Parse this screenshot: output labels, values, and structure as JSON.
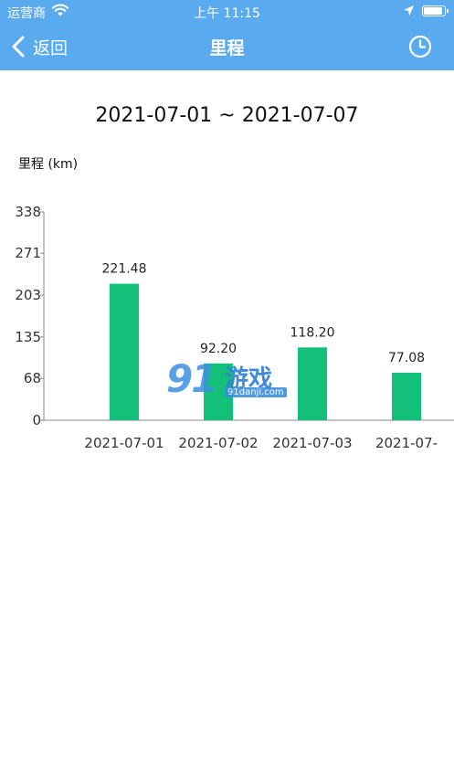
{
  "status_bar": {
    "carrier": "运营商",
    "time": "上午 11:15",
    "icons": [
      "wifi-icon",
      "location-arrow-icon",
      "battery-icon"
    ]
  },
  "nav": {
    "back_label": "返回",
    "title": "里程",
    "icons": [
      "chevron-left-icon",
      "clock-icon"
    ]
  },
  "date_range": "2021-07-01 ~ 2021-07-07",
  "unit_label": "里程 (km)",
  "colors": {
    "nav_background": "#5aaaf0",
    "bar": "#13c07a",
    "axis": "#888888"
  },
  "watermark": {
    "logo_text": "91",
    "brand": "游戏",
    "site": "91danji.com"
  },
  "chart_data": {
    "type": "bar",
    "categories": [
      "2021-07-01",
      "2021-07-02",
      "2021-07-03",
      "2021-07-"
    ],
    "values": [
      221.48,
      92.2,
      118.2,
      77.08
    ],
    "value_labels": [
      "221.48",
      "92.20",
      "118.20",
      "77.08"
    ],
    "ylabel": "里程 (km)",
    "yticks": [
      0,
      68,
      135,
      203,
      271,
      338
    ],
    "ylim": [
      0,
      338
    ],
    "grid": false
  }
}
